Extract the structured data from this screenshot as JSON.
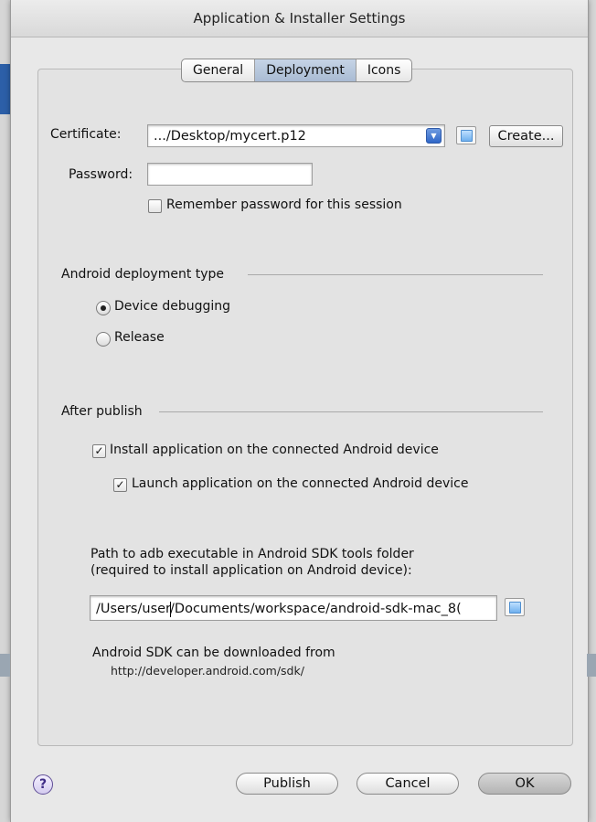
{
  "window": {
    "title": "Application & Installer Settings"
  },
  "tabs": [
    {
      "label": "General",
      "active": false
    },
    {
      "label": "Deployment",
      "active": true
    },
    {
      "label": "Icons",
      "active": false
    }
  ],
  "certificate": {
    "label": "Certificate:",
    "value": ".../Desktop/mycert.p12",
    "create_label": "Create..."
  },
  "password": {
    "label": "Password:",
    "value": "",
    "remember_label": "Remember password for this session",
    "remember_checked": false
  },
  "deployment_type": {
    "header": "Android deployment type",
    "options": [
      {
        "label": "Device debugging",
        "selected": true
      },
      {
        "label": "Release",
        "selected": false
      }
    ]
  },
  "after_publish": {
    "header": "After publish",
    "install_label": "Install application on the connected Android device",
    "install_checked": true,
    "launch_label": "Launch application on the connected Android device",
    "launch_checked": true
  },
  "adb": {
    "label_line1": "Path to adb executable in Android SDK tools folder",
    "label_line2": "(required to install application on Android device):",
    "path_before_caret": "/Users/user",
    "path_after_caret": "/Documents/workspace/android-sdk-mac_8("
  },
  "sdk": {
    "note": "Android SDK can be downloaded from",
    "url": "http://developer.android.com/sdk/"
  },
  "buttons": {
    "help": "?",
    "publish": "Publish",
    "cancel": "Cancel",
    "ok": "OK"
  },
  "colors": {
    "selected_tab": "#b3c4da",
    "dropdown_accent": "#2f66c8",
    "help_accent": "#3e2b86"
  }
}
